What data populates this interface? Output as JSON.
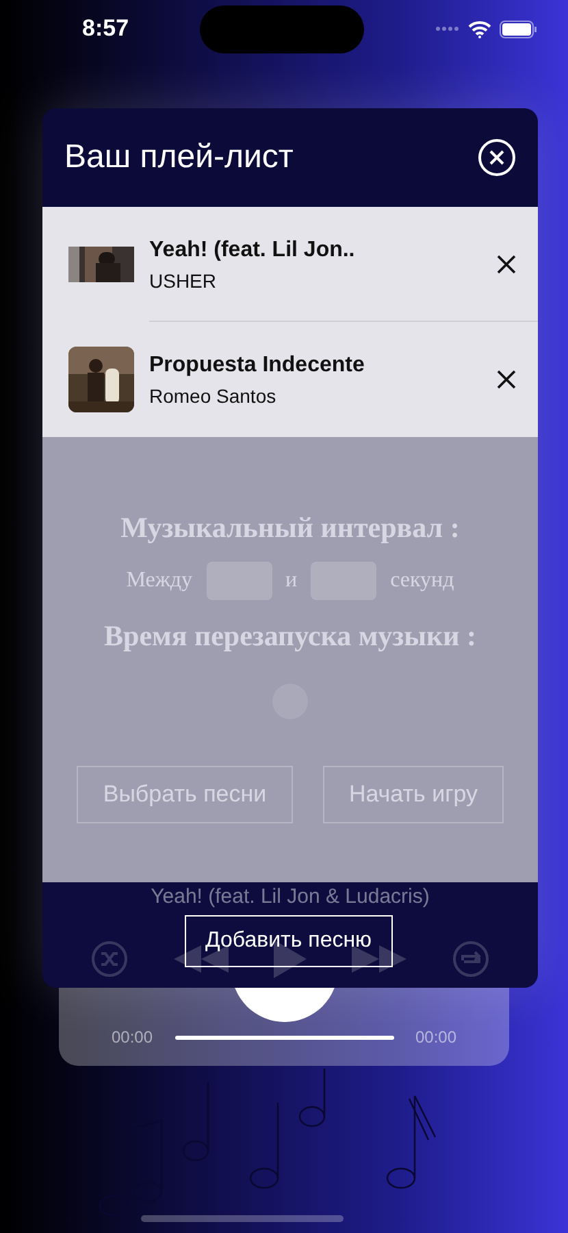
{
  "status_bar": {
    "time": "8:57"
  },
  "background_screen": {
    "interval_heading": "Музыкальный интервал :",
    "between_label": "Между",
    "and_label": "и",
    "seconds_label": "секунд",
    "restart_heading": "Время перезапуска музыки :",
    "choose_songs_button": "Выбрать песни",
    "start_game_button": "Начать игру",
    "now_playing": "Yeah! (feat. Lil Jon & Ludacris)",
    "elapsed": "00:00",
    "duration": "00:00"
  },
  "playlist_dialog": {
    "title": "Ваш плей-лист",
    "songs": [
      {
        "title": "Yeah! (feat. Lil Jon..",
        "artist": "USHER"
      },
      {
        "title": "Propuesta Indecente",
        "artist": "Romeo Santos"
      }
    ],
    "add_button": "Добавить песню"
  }
}
